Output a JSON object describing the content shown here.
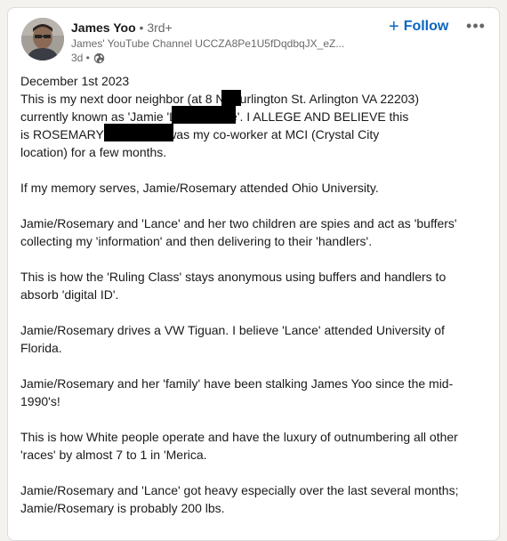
{
  "author": {
    "name": "James Yoo",
    "degree": "• 3rd+",
    "subtitle": "James' YouTube Channel UCCZA8Pe1U5fDqdbqJX_eZ...",
    "time": "3d •",
    "visibility_icon": "globe-icon"
  },
  "actions": {
    "follow_label": "Follow",
    "follow_icon": "plus-icon",
    "more_icon": "ellipsis-icon"
  },
  "colors": {
    "accent": "#0a66c2"
  },
  "post": {
    "p1": [
      "December 1st 2023",
      "This is my next door neighbor (at 8     N. Burlington St. Arlington VA 22203)",
      "currently known as 'Jamie                    'Lance's wife'. I ALLEGE AND BELIEVE this",
      "is ROSEMARY                      Rosemary was my co-worker at MCI (Crystal City",
      "location) for a few months."
    ],
    "p2": [
      "If my memory serves, Jamie/Rosemary attended Ohio University."
    ],
    "p3": [
      "Jamie/Rosemary and 'Lance' and her two children are spies and act as 'buffers'",
      "collecting my 'information' and then delivering to their 'handlers'."
    ],
    "p4": [
      "This is how the 'Ruling Class' stays anonymous using buffers and handlers to",
      "absorb 'digital ID'."
    ],
    "p5": [
      "Jamie/Rosemary drives a VW Tiguan. I believe 'Lance' attended University of",
      "Florida."
    ],
    "p6": [
      "Jamie/Rosemary and her 'family' have been stalking James Yoo since the mid-",
      "1990's!"
    ],
    "p7": [
      "This is how White people operate and have the luxury of outnumbering all other",
      "'races' by almost 7 to 1 in 'Merica."
    ],
    "p8": [
      "Jamie/Rosemary and 'Lance' got heavy especially over the last several months;",
      "Jamie/Rosemary is probably 200 lbs."
    ]
  }
}
